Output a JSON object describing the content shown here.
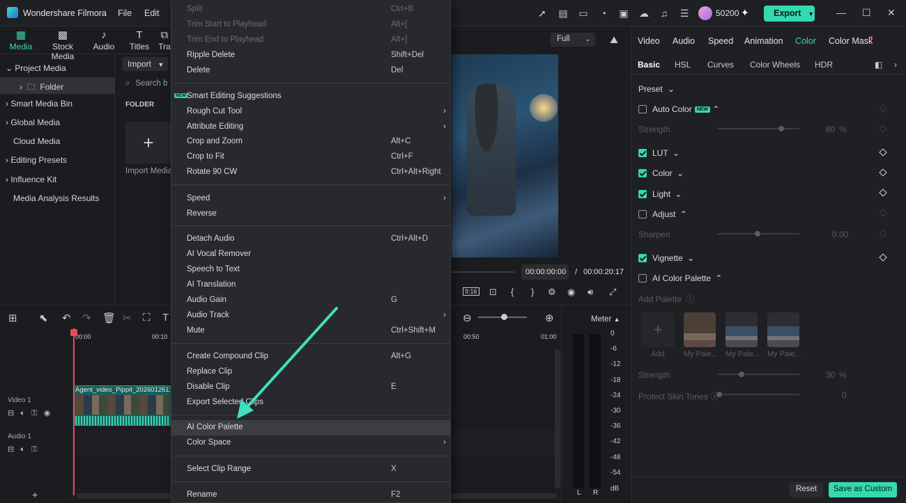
{
  "app": {
    "title": "Wondershare Filmora",
    "menus": [
      "File",
      "Edit"
    ],
    "credits": "50200",
    "export_label": "Export"
  },
  "media_tabs": [
    {
      "label": "Media",
      "icon": "media-icon"
    },
    {
      "label": "Stock Media",
      "icon": "stock-media-icon"
    },
    {
      "label": "Audio",
      "icon": "music-note-icon"
    },
    {
      "label": "Titles",
      "icon": "titles-icon"
    },
    {
      "label": "Tra",
      "icon": "transitions-icon"
    }
  ],
  "sidebar": {
    "items": [
      "Project Media",
      "Folder",
      "Smart Media Bin",
      "Global Media",
      "Cloud Media",
      "Editing Presets",
      "Influence Kit",
      "Media Analysis Results"
    ]
  },
  "media": {
    "import_label": "Import",
    "search_placeholder": "Search b",
    "folder_label": "FOLDER",
    "import_media_label": "Import Media"
  },
  "context_menu": [
    {
      "label": "Split",
      "shortcut": "Ctrl+B",
      "disabled": true
    },
    {
      "label": "Trim Start to Playhead",
      "shortcut": "Alt+[",
      "disabled": true
    },
    {
      "label": "Trim End to Playhead",
      "shortcut": "Alt+]",
      "disabled": true
    },
    {
      "label": "Ripple Delete",
      "shortcut": "Shift+Del"
    },
    {
      "label": "Delete",
      "shortcut": "Del"
    },
    {
      "label": "Smart Editing Suggestions",
      "badge": "NEW"
    },
    {
      "label": "Rough Cut Tool",
      "submenu": true
    },
    {
      "label": "Attribute Editing",
      "submenu": true
    },
    {
      "label": "Crop and Zoom",
      "shortcut": "Alt+C"
    },
    {
      "label": "Crop to Fit",
      "shortcut": "Ctrl+F"
    },
    {
      "label": "Rotate 90 CW",
      "shortcut": "Ctrl+Alt+Right"
    },
    {
      "label": "Speed",
      "submenu": true
    },
    {
      "label": "Reverse"
    },
    {
      "label": "Detach Audio",
      "shortcut": "Ctrl+Alt+D"
    },
    {
      "label": "AI Vocal Remover"
    },
    {
      "label": "Speech to Text"
    },
    {
      "label": "AI Translation"
    },
    {
      "label": "Audio Gain",
      "shortcut": "G"
    },
    {
      "label": "Audio Track",
      "submenu": true
    },
    {
      "label": "Mute",
      "shortcut": "Ctrl+Shift+M"
    },
    {
      "label": "Create Compound Clip",
      "shortcut": "Alt+G"
    },
    {
      "label": "Replace Clip"
    },
    {
      "label": "Disable Clip",
      "shortcut": "E"
    },
    {
      "label": "Export Selected Clips"
    },
    {
      "label": "AI Color Palette",
      "highlighted": true
    },
    {
      "label": "Color Space",
      "submenu": true
    },
    {
      "label": "Select Clip Range",
      "shortcut": "X"
    },
    {
      "label": "Rename",
      "shortcut": "F2"
    }
  ],
  "preview": {
    "quality": "Full",
    "current_time": "00:00:00:00",
    "separator": "/",
    "total_time": "00:00:20:17",
    "aspect_label": "9:16"
  },
  "timeline": {
    "ruler": [
      "00:00",
      "00:10",
      "00:50",
      "01:00"
    ],
    "video_track": "Video 1",
    "audio_track": "Audio 1",
    "clip_name": "Agent_video_Pippit_20260126115",
    "meter_label": "Meter",
    "meter_ticks": [
      "0",
      "-6",
      "-12",
      "-18",
      "-24",
      "-30",
      "-36",
      "-42",
      "-48",
      "-54",
      "dB"
    ],
    "meter_channels": [
      "L",
      "R"
    ]
  },
  "panel": {
    "tabs": [
      "Video",
      "Audio",
      "Speed",
      "Animation",
      "Color",
      "Color Mask"
    ],
    "subtabs": [
      "Basic",
      "HSL",
      "Curves",
      "Color Wheels",
      "HDR"
    ],
    "preset": "Preset",
    "auto_color": "Auto Color",
    "new_badge": "NEW",
    "strength": "Strength",
    "strength_value": "80",
    "percent": "%",
    "lut": "LUT",
    "color": "Color",
    "light": "Light",
    "adjust": "Adjust",
    "sharpen": "Sharpen",
    "sharpen_value": "0.00",
    "vignette": "Vignette",
    "ai_color_palette": "AI Color Palette",
    "add_palette": "Add Palette",
    "add": "Add",
    "palettes": [
      "My Pale...",
      "My Pale...",
      "My Pale..."
    ],
    "strength2_value": "30",
    "protect_skin": "Protect Skin Tones",
    "protect_value": "0",
    "reset": "Reset",
    "save_custom": "Save as Custom"
  },
  "colors": {
    "accent": "#35d9b0",
    "playhead": "#e74c5c",
    "arrow": "#3ee0c0"
  }
}
